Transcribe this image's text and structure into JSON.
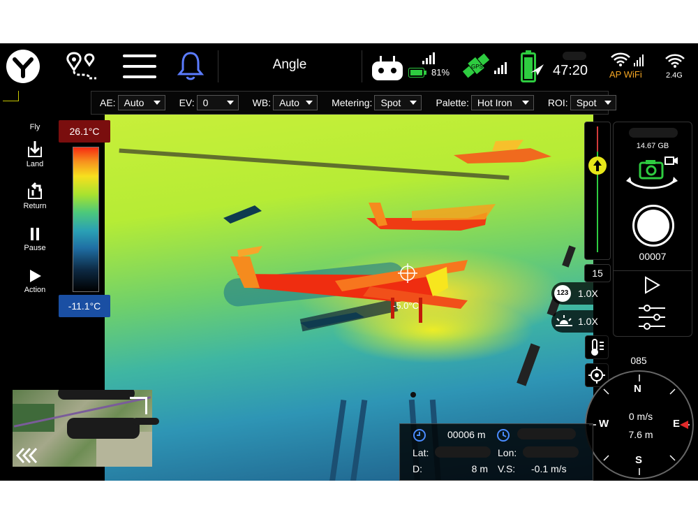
{
  "topbar": {
    "title": "Angle",
    "battery_percent": "81%",
    "gps_label": "GPS",
    "flight_time": "47:20",
    "ap_wifi_label": "AP WiFi",
    "wifi_band": "2.4G"
  },
  "settings": {
    "ae": {
      "label": "AE:",
      "value": "Auto"
    },
    "ev": {
      "label": "EV:",
      "value": "0"
    },
    "wb": {
      "label": "WB:",
      "value": "Auto"
    },
    "metering": {
      "label": "Metering:",
      "value": "Spot"
    },
    "palette": {
      "label": "Palette:",
      "value": "Hot Iron"
    },
    "roi": {
      "label": "ROI:",
      "value": "Spot"
    }
  },
  "left": {
    "fly": "Fly",
    "land": "Land",
    "return": "Return",
    "pause": "Pause",
    "action": "Action"
  },
  "thermal": {
    "max_temp": "26.1°C",
    "min_temp": "-11.1°C",
    "spot_temp": "-5.0°C",
    "palette_colors": {
      "max_bg": "#7a0e0e",
      "min_bg": "#1a4fa3"
    }
  },
  "gimbal": {
    "angle_value": "15"
  },
  "zoom": {
    "digital_zoom": "1.0X",
    "ir_zoom": "1.0X",
    "digital_icon_label": "123"
  },
  "right_panel": {
    "storage": "14.67 GB",
    "photo_count": "00007"
  },
  "compass": {
    "heading": "085",
    "n": "N",
    "s": "S",
    "e": "E",
    "w": "W",
    "vertical_speed_display": "0 m/s",
    "distance_display": "7.6 m"
  },
  "info": {
    "altitude": "00006 m",
    "lat_label": "Lat:",
    "lon_label": "Lon:",
    "d_label": "D:",
    "d_value": "8 m",
    "vs_label": "V.S:",
    "vs_value": "-0.1 m/s"
  },
  "colors": {
    "accent_green": "#2ecc40",
    "bell_blue": "#5b7cff",
    "ap_wifi": "#f5a623",
    "up_arrow": "#e6e619"
  }
}
